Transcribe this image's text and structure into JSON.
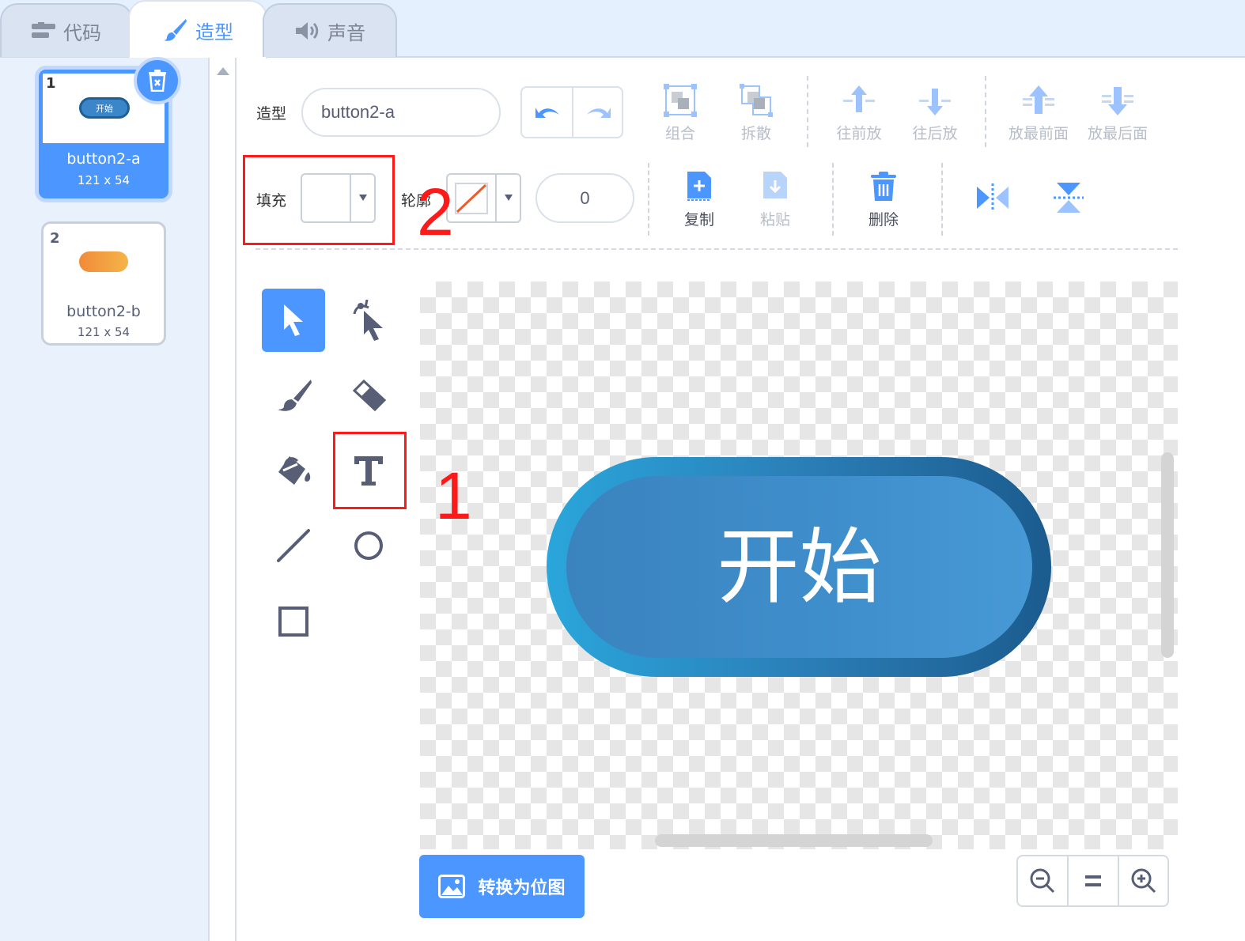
{
  "tabs": [
    {
      "label": "代码",
      "icon": "code-blocks-icon",
      "active": false
    },
    {
      "label": "造型",
      "icon": "brush-icon",
      "active": true
    },
    {
      "label": "声音",
      "icon": "speaker-icon",
      "active": false
    }
  ],
  "costumes": [
    {
      "number": "1",
      "name": "button2-a",
      "size": "121 x 54",
      "thumb_text": "开始",
      "selected": true
    },
    {
      "number": "2",
      "name": "button2-b",
      "size": "121 x 54",
      "selected": false
    }
  ],
  "toolbar": {
    "costume_label": "造型",
    "costume_name": "button2-a",
    "group": "组合",
    "ungroup": "拆散",
    "forward": "往前放",
    "backward": "往后放",
    "front": "放最前面",
    "back": "放最后面",
    "fill_label": "填充",
    "outline_label": "轮廓",
    "outline_width": "0",
    "copy": "复制",
    "paste": "粘贴",
    "delete": "删除"
  },
  "tools": [
    "select-icon",
    "reshape-icon",
    "brush-icon",
    "eraser-icon",
    "fill-icon",
    "text-icon",
    "line-icon",
    "circle-icon",
    "rectangle-icon"
  ],
  "canvas": {
    "button_text": "开始"
  },
  "convert_button": "转换为位图",
  "annotations": {
    "one": "1",
    "two": "2"
  },
  "colors": {
    "accent": "#4c97ff",
    "highlight": "#ff1a1a"
  }
}
